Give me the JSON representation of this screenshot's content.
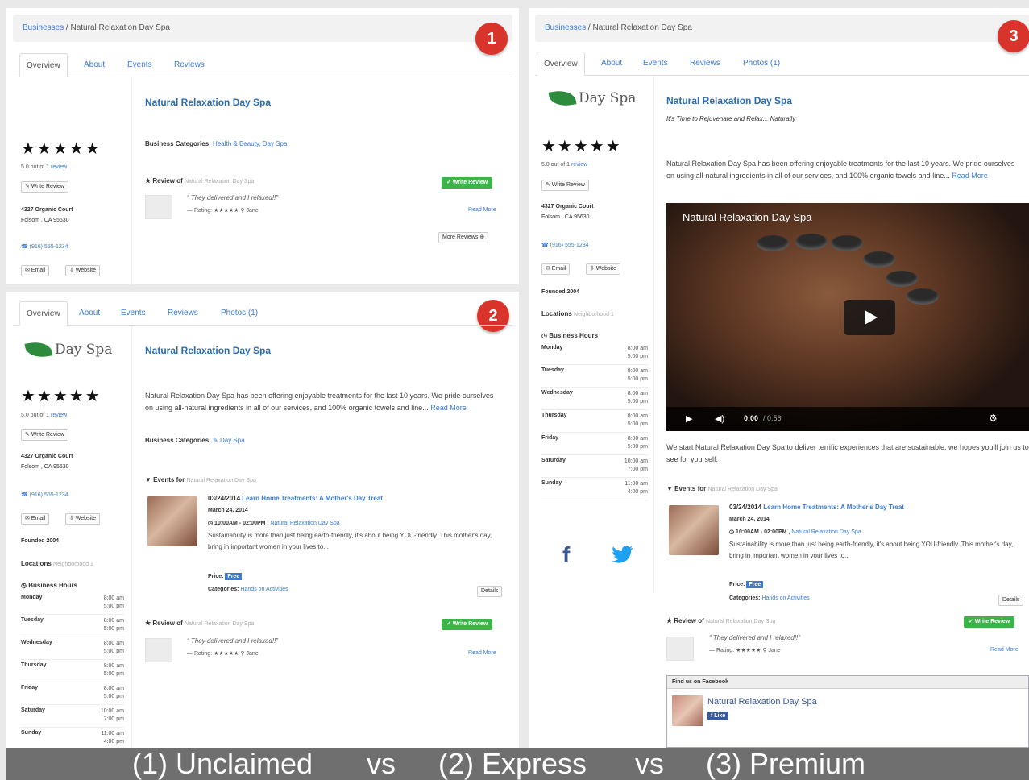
{
  "common": {
    "breadcrumb_link": "Businesses",
    "breadcrumb_current": "Natural Relaxation Day Spa",
    "business_name": "Natural Relaxation Day Spa",
    "stars": "★★★★★",
    "rating_text": "5.0 out of 1",
    "review_link": "review",
    "write_review": "✎ Write Review",
    "write_review_green": "✓ Write Review",
    "address_line1": "4327 Organic Court",
    "address_line2": "Folsom , CA 95630",
    "phone": "☎ (916) 555-1234",
    "email_btn": "✉ Email",
    "website_btn": "⇩ Website",
    "review_of_label": "★ Review of",
    "review_of_name": "Natural Relaxation Day Spa",
    "review_quote": "“ They delivered and I relaxed!!”",
    "review_meta": "— Rating: ★★★★★ ⚲ Jane",
    "read_more": "Read More",
    "description": "Natural Relaxation Day Spa has been offering enjoyable treatments for the last 10 years. We pride ourselves on using all-natural ingredients in all of our services, and 100% organic towels and line...",
    "read_more_inline": "Read More",
    "founded": "Founded 2004",
    "locations_label": "Locations",
    "locations_sub": "Neighborhood 1",
    "hours_title": "◷ Business Hours",
    "logo_text": "Day Spa",
    "events_for_label": "▼ Events for",
    "events_for_name": "Natural Relaxation Day Spa",
    "event_date": "03/24/2014",
    "event_title": "Learn Home Treatments: A Mother's Day Treat",
    "event_day": "March 24, 2014",
    "event_time": "◷ 10:00AM - 02:00PM ,",
    "event_venue": "Natural Relaxation Day Spa",
    "event_desc": "Sustainability is more than just being earth-friendly, it's about being YOU-friendly. This mother's day, bring in important women in your lives to...",
    "price_label": "Price:",
    "price_value": "Free",
    "categories_label": "Categories:",
    "categories_value": "Hands on Activities",
    "details_btn": "Details",
    "hours": [
      {
        "day": "Monday",
        "time": "8:00 am\n5:00 pm"
      },
      {
        "day": "Tuesday",
        "time": "8:00 am\n5:00 pm"
      },
      {
        "day": "Wednesday",
        "time": "8:00 am\n5:00 pm"
      },
      {
        "day": "Thursday",
        "time": "8:00 am\n5:00 pm"
      },
      {
        "day": "Friday",
        "time": "8:00 am\n5:00 pm"
      },
      {
        "day": "Saturday",
        "time": "10:00 am\n7:00 pm"
      },
      {
        "day": "Sunday",
        "time": "11:00 am\n4:00 pm"
      }
    ]
  },
  "tabs": {
    "overview": "Overview",
    "about": "About",
    "events": "Events",
    "reviews": "Reviews",
    "photos": "Photos (1)"
  },
  "panel1": {
    "badge": "1",
    "categories_label": "Business Categories:",
    "categories_value": "Health & Beauty, Day Spa",
    "more_reviews": "More Reviews ⊕"
  },
  "panel2": {
    "badge": "2",
    "categories_label": "Business Categories:",
    "categories_value": "✎ Day Spa"
  },
  "panel3": {
    "badge": "3",
    "tagline": "It's Time to Rejuvenate and Relax... Naturally",
    "video_title": "Natural Relaxation Day Spa",
    "video_time": "0:00",
    "video_duration": "/ 0:56",
    "after_video": "We start Natural Relaxation Day Spa to deliver terrific experiences that are sustainable, we hopes you'll join us to see for yourself.",
    "facebook_header": "Find us on Facebook",
    "facebook_page": "Natural Relaxation Day Spa",
    "facebook_like": "f Like"
  },
  "caption": {
    "unclaimed": "(1) Unclaimed",
    "vs1": "vs",
    "express": "(2) Express",
    "vs2": "vs",
    "premium": "(3) Premium"
  },
  "colors": {
    "link": "#3a7bd5",
    "badge": "#d9342b",
    "green_button": "#3cb449",
    "facebook": "#3b5998",
    "twitter": "#1da1f2"
  }
}
